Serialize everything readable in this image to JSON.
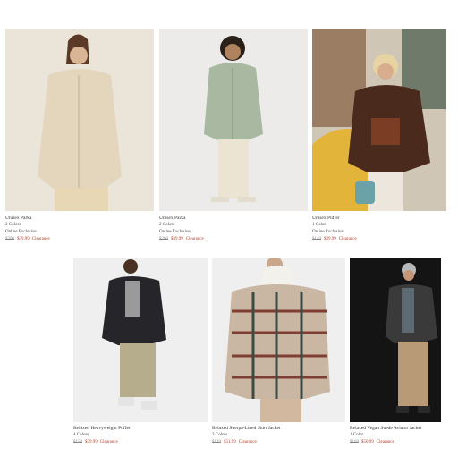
{
  "products": [
    {
      "name": "Unisex Parka",
      "colors": "2 Colors",
      "exclusive": "Online Exclusive",
      "orig": "$200",
      "sale": "$39.99",
      "tag": "Clearance",
      "image": "woman in cream parka"
    },
    {
      "name": "Unisex Parka",
      "colors": "2 Colors",
      "exclusive": "Online Exclusive",
      "orig": "$200",
      "sale": "$39.99",
      "tag": "Clearance",
      "image": "woman in sage green parka"
    },
    {
      "name": "Unisex Puffer",
      "colors": "1 Color",
      "exclusive": "Online Exclusive",
      "orig": "$140",
      "sale": "$39.99",
      "tag": "Clearance",
      "image": "woman in brown leather puffer"
    },
    {
      "name": "Relaxed Heavyweight Puffer",
      "colors": "4 Colors",
      "exclusive": "",
      "orig": "$150",
      "sale": "$39.99",
      "tag": "Clearance",
      "image": "man in black puffer"
    },
    {
      "name": "Relaxed Sherpa-Lined Shirt Jacket",
      "colors": "3 Colors",
      "exclusive": "",
      "orig": "$120",
      "sale": "$51.99",
      "tag": "Clearance",
      "image": "man in plaid sherpa jacket"
    },
    {
      "name": "Relaxed Vegan Suede Aviator Jacket",
      "colors": "1 Color",
      "exclusive": "",
      "orig": "$160",
      "sale": "$50.99",
      "tag": "Clearance",
      "image": "man in black aviator jacket"
    }
  ]
}
